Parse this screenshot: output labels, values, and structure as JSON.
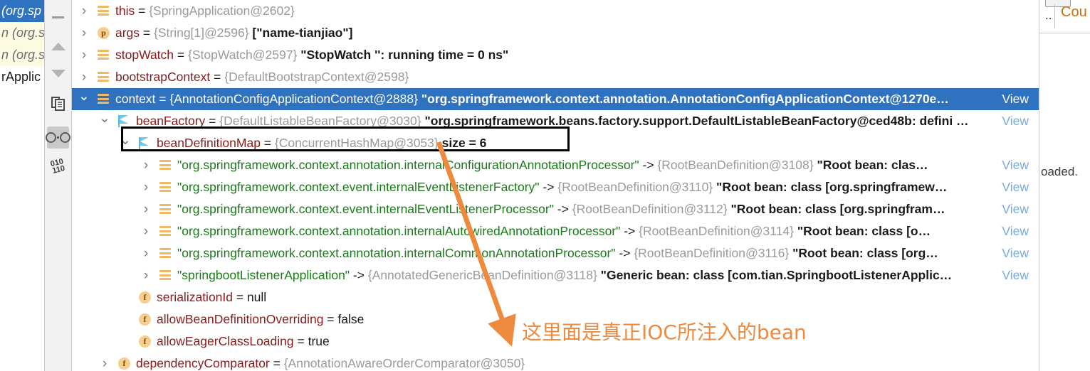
{
  "frames_panel": {
    "rows": [
      {
        "text": "(org.sp",
        "state": "selected"
      },
      {
        "text": "n (org.s",
        "state": "tint"
      },
      {
        "text": "n (org.s",
        "state": "tint"
      },
      {
        "text": "rApplic",
        "state": "plain"
      }
    ]
  },
  "toolbar": {
    "items": [
      {
        "name": "collapse-all-button",
        "icon": "minus-icon"
      },
      {
        "name": "scroll-up-button",
        "icon": "triangle-up-icon"
      },
      {
        "name": "scroll-down-button",
        "icon": "triangle-down-icon"
      },
      {
        "name": "copy-button",
        "icon": "copy-icon"
      },
      {
        "name": "watches-button",
        "icon": "glasses-icon"
      },
      {
        "name": "binary-view-button",
        "icon": "binary-icon"
      }
    ],
    "binary_top": "010",
    "binary_bottom": "110"
  },
  "variables": {
    "view_label": "View",
    "rows": [
      {
        "indent": 0,
        "arrow": "closed",
        "icon": "list-icon",
        "name": "this",
        "eq": " = ",
        "type": "{SpringApplication@2602}",
        "value": "",
        "selected": false,
        "view": false
      },
      {
        "indent": 0,
        "arrow": "closed",
        "icon": "circle-p-icon",
        "icon_letter": "p",
        "name": "args",
        "eq": " = ",
        "type": "{String[1]@2596}",
        "value": "[\"name-tianjiao\"]",
        "selected": false,
        "view": false
      },
      {
        "indent": 0,
        "arrow": "closed",
        "icon": "list-icon",
        "name": "stopWatch",
        "eq": " = ",
        "type": "{StopWatch@2597}",
        "value": "\"StopWatch '': running time = 0 ns\"",
        "selected": false,
        "view": false
      },
      {
        "indent": 0,
        "arrow": "closed",
        "icon": "list-icon",
        "name": "bootstrapContext",
        "eq": " = ",
        "type": "{DefaultBootstrapContext@2598}",
        "value": "",
        "selected": false,
        "view": false
      },
      {
        "indent": 0,
        "arrow": "open",
        "icon": "list-icon",
        "name": "context",
        "eq": " = ",
        "type": "{AnnotationConfigApplicationContext@2888}",
        "value": "\"org.springframework.context.annotation.AnnotationConfigApplicationContext@1270e…",
        "selected": true,
        "view": true
      },
      {
        "indent": 1,
        "arrow": "open",
        "icon": "flag-icon",
        "name": "beanFactory",
        "eq": " = ",
        "type": "{DefaultListableBeanFactory@3030}",
        "value": "\"org.springframework.beans.factory.support.DefaultListableBeanFactory@ced48b: defini …",
        "selected": false,
        "view": true
      },
      {
        "indent": 2,
        "arrow": "open",
        "icon": "flag-icon",
        "name": "beanDefinitionMap",
        "eq": " = ",
        "type": "{ConcurrentHashMap@3053}",
        "value": "size = 6",
        "selected": false,
        "view": false,
        "boxed": true
      },
      {
        "indent": 3,
        "arrow": "closed",
        "icon": "list-icon",
        "str": "\"org.springframework.context.annotation.internalConfigurationAnnotationProcessor\"",
        "arrow_text": " -> ",
        "type": "{RootBeanDefinition@3108}",
        "value": "\"Root bean: clas…",
        "selected": false,
        "view": true
      },
      {
        "indent": 3,
        "arrow": "closed",
        "icon": "list-icon",
        "str": "\"org.springframework.context.event.internalEventListenerFactory\"",
        "arrow_text": " -> ",
        "type": "{RootBeanDefinition@3110}",
        "value": "\"Root bean: class [org.springframew…",
        "selected": false,
        "view": true
      },
      {
        "indent": 3,
        "arrow": "closed",
        "icon": "list-icon",
        "str": "\"org.springframework.context.event.internalEventListenerProcessor\"",
        "arrow_text": " -> ",
        "type": "{RootBeanDefinition@3112}",
        "value": "\"Root bean: class [org.springfram…",
        "selected": false,
        "view": true
      },
      {
        "indent": 3,
        "arrow": "closed",
        "icon": "list-icon",
        "str": "\"org.springframework.context.annotation.internalAutowiredAnnotationProcessor\"",
        "arrow_text": " -> ",
        "type": "{RootBeanDefinition@3114}",
        "value": "\"Root bean: class [o…",
        "selected": false,
        "view": true
      },
      {
        "indent": 3,
        "arrow": "closed",
        "icon": "list-icon",
        "str": "\"org.springframework.context.annotation.internalCommonAnnotationProcessor\"",
        "arrow_text": " -> ",
        "type": "{RootBeanDefinition@3116}",
        "value": "\"Root bean: class [org…",
        "selected": false,
        "view": true
      },
      {
        "indent": 3,
        "arrow": "closed",
        "icon": "list-icon",
        "str": "\"springbootListenerApplication\"",
        "arrow_text": " -> ",
        "type": "{AnnotatedGenericBeanDefinition@3118}",
        "value": "\"Generic bean: class [com.tian.SpringbootListenerApplic…",
        "selected": false,
        "view": true
      },
      {
        "indent": 2,
        "arrow": "none",
        "icon": "circle-f-icon",
        "icon_letter": "f",
        "name": "serializationId",
        "eq": " = ",
        "type": "",
        "value": "null",
        "plain": true,
        "selected": false,
        "view": false
      },
      {
        "indent": 2,
        "arrow": "none",
        "icon": "circle-f-icon",
        "icon_letter": "f",
        "name": "allowBeanDefinitionOverriding",
        "eq": " = ",
        "type": "",
        "value": "false",
        "plain": true,
        "selected": false,
        "view": false
      },
      {
        "indent": 2,
        "arrow": "none",
        "icon": "circle-f-icon",
        "icon_letter": "f",
        "name": "allowEagerClassLoading",
        "eq": " = ",
        "type": "",
        "value": "true",
        "plain": true,
        "selected": false,
        "view": false
      },
      {
        "indent": 1,
        "arrow": "closed",
        "icon": "circle-f-icon",
        "icon_letter": "f",
        "name": "dependencyComparator",
        "eq": " = ",
        "type": "{AnnotationAwareOrderComparator@3050}",
        "value": "",
        "selected": false,
        "view": false
      }
    ]
  },
  "annotation": {
    "text": "这里面是真正IOC所注入的bean",
    "color": "#ee8a3e"
  },
  "right_panel": {
    "tab_label": "Cou",
    "dots": "..",
    "status_text": "oaded."
  },
  "colors": {
    "selection_blue": "#2f72c0",
    "string_green": "#1a7a1a",
    "name_red": "#871b1b",
    "type_gray": "#9a9a9a",
    "annotation_orange": "#ee8a3e",
    "link_blue": "#7aa8dd"
  }
}
